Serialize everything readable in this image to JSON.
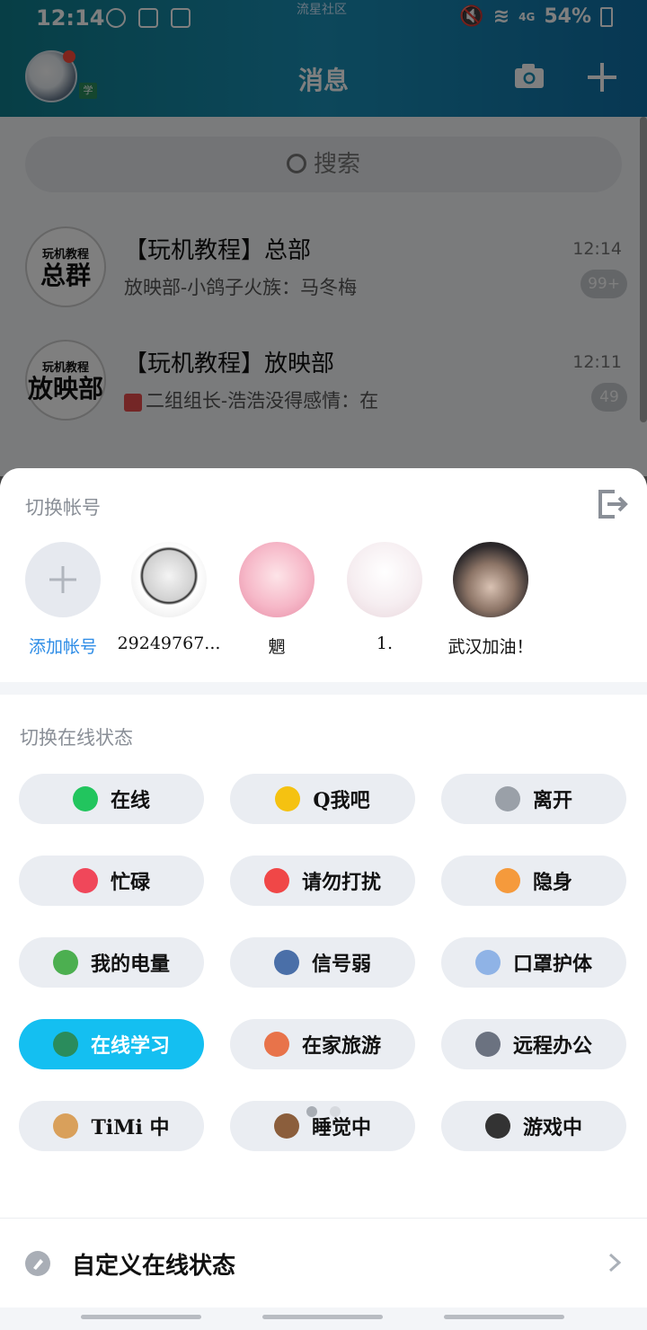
{
  "status_bar": {
    "time": "12:14",
    "carrier": "流星社区",
    "signal": "4G",
    "battery": "54%"
  },
  "header": {
    "title": "消息",
    "avatar_badge": "学"
  },
  "search": {
    "placeholder": "搜索"
  },
  "chats": [
    {
      "avatar_top": "玩机教程",
      "avatar_big": "总群",
      "name": "【玩机教程】总部",
      "message": "放映部-小鸽子火族：马冬梅",
      "time": "12:14",
      "badge": "99+"
    },
    {
      "avatar_top": "玩机教程",
      "avatar_big": "放映部",
      "name": "【玩机教程】放映部",
      "message": "二组组长-浩浩没得感情：在",
      "time": "12:11",
      "badge": "49"
    }
  ],
  "account_switch": {
    "title": "切换帐号",
    "accounts": [
      {
        "label": "添加帐号",
        "color": "#e6e9ef"
      },
      {
        "label": "29249767...",
        "color": "#d9d9d9"
      },
      {
        "label": "魍",
        "color": "#f2b8c6"
      },
      {
        "label": "1.",
        "color": "#f3e6ea"
      },
      {
        "label": "武汉加油！",
        "color": "#4a4a4e"
      }
    ]
  },
  "online_status": {
    "title": "切换在线状态",
    "items": [
      {
        "label": "在线",
        "icon": "online-dot-icon",
        "color": "#22c55e"
      },
      {
        "label": "Q我吧",
        "icon": "smile-icon",
        "color": "#f5c211"
      },
      {
        "label": "离开",
        "icon": "clock-icon",
        "color": "#9aa0a8"
      },
      {
        "label": "忙碌",
        "icon": "minus-circle-icon",
        "color": "#f0475a"
      },
      {
        "label": "请勿打扰",
        "icon": "no-entry-icon",
        "color": "#f04747"
      },
      {
        "label": "隐身",
        "icon": "equals-circle-icon",
        "color": "#f59a3c"
      },
      {
        "label": "我的电量",
        "icon": "battery-icon",
        "color": "#4caf50"
      },
      {
        "label": "信号弱",
        "icon": "signal-icon",
        "color": "#4a6fa8"
      },
      {
        "label": "口罩护体",
        "icon": "mask-icon",
        "color": "#8fb3e6"
      },
      {
        "label": "在线学习",
        "icon": "blackboard-icon",
        "color": "#2a8c5c"
      },
      {
        "label": "在家旅游",
        "icon": "house-icon",
        "color": "#e8734a"
      },
      {
        "label": "远程办公",
        "icon": "laptop-icon",
        "color": "#6b7280"
      },
      {
        "label": "TiMi 中",
        "icon": "timi-icon",
        "color": "#d9a05b"
      },
      {
        "label": "睡觉中",
        "icon": "bed-icon",
        "color": "#8b5e3c"
      },
      {
        "label": "游戏中",
        "icon": "gamepad-icon",
        "color": "#333333"
      }
    ],
    "active_label": "在线学习"
  },
  "custom_status": {
    "label": "自定义在线状态"
  }
}
